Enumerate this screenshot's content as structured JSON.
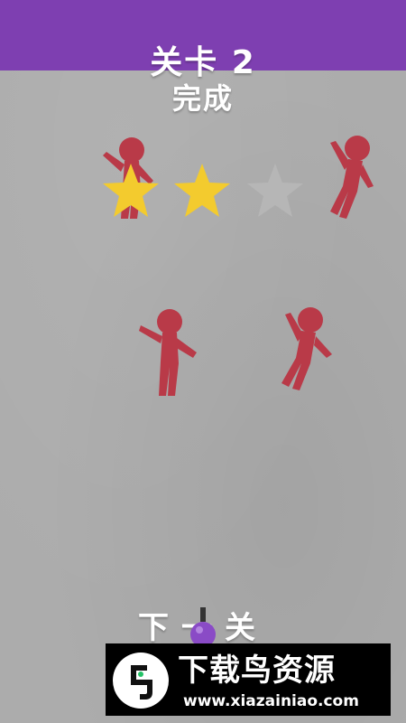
{
  "header": {
    "level_title": "关卡 2",
    "status": "完成"
  },
  "rating": {
    "stars_earned": 2,
    "stars_total": 3,
    "star_color": "#f3cb2e",
    "empty_star_color": "#b9b9b9"
  },
  "actions": {
    "next_label": "下一关"
  },
  "watermark": {
    "title": "下载鸟资源",
    "url": "www.xiazainiao.com"
  },
  "colors": {
    "top_bar": "#7e3fb1",
    "figure": "#b93a48",
    "background": "#acacac",
    "pointer": "#8a4bc6"
  }
}
